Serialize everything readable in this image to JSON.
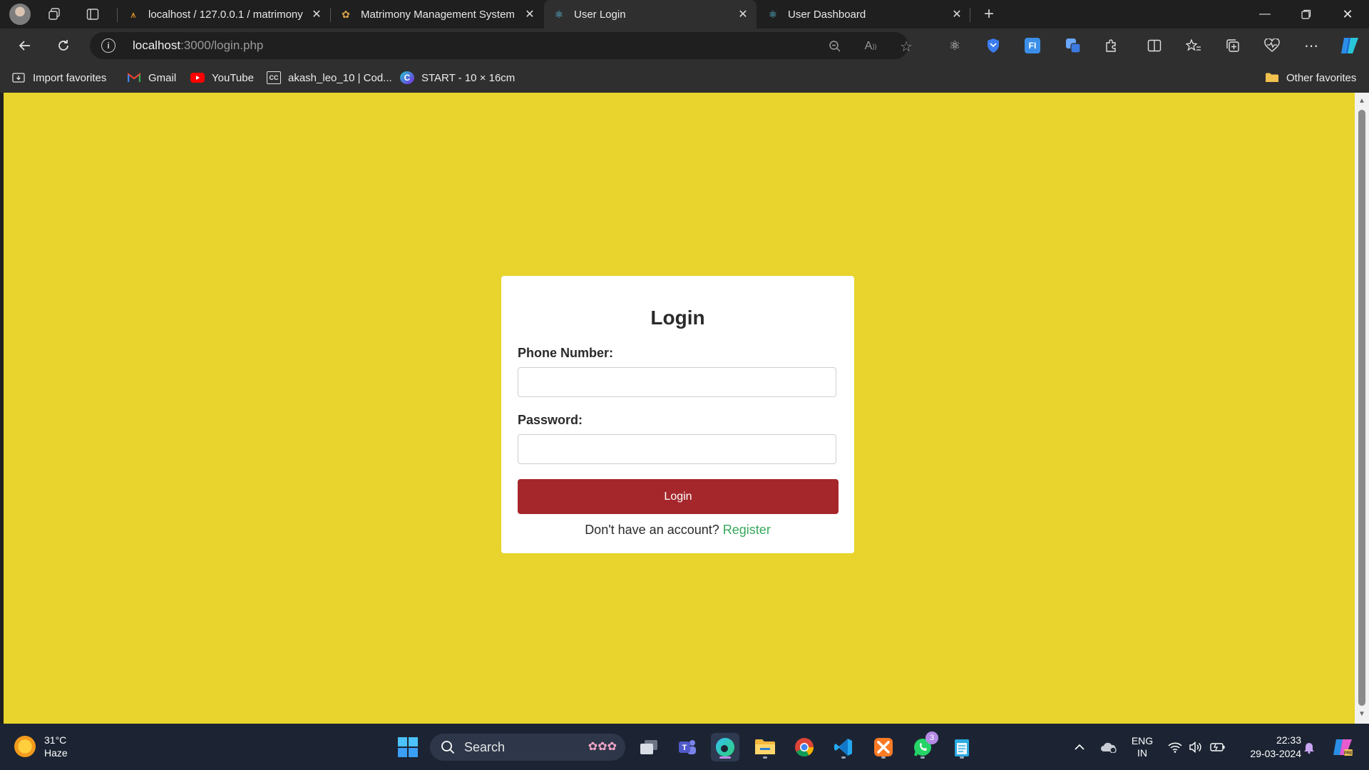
{
  "browser": {
    "tabs": [
      {
        "title": "localhost / 127.0.0.1 / matrimony",
        "favicon": "phpmyadmin-icon"
      },
      {
        "title": "Matrimony Management System",
        "favicon": "matrimony-icon"
      },
      {
        "title": "User Login",
        "favicon": "react-icon"
      },
      {
        "title": "User Dashboard",
        "favicon": "react-icon"
      }
    ],
    "active_tab_index": 2,
    "address": {
      "host": "localhost",
      "path": ":3000/login.php"
    },
    "favorites": [
      {
        "label": "Import favorites",
        "icon": "import-icon"
      },
      {
        "label": "Gmail",
        "icon": "gmail-icon"
      },
      {
        "label": "YouTube",
        "icon": "youtube-icon"
      },
      {
        "label": "akash_leo_10 | Cod...",
        "icon": "codechef-icon"
      },
      {
        "label": "START - 10 × 16cm",
        "icon": "canva-icon"
      }
    ],
    "other_favorites": "Other favorites"
  },
  "page": {
    "background": "#e8d42c",
    "form": {
      "title": "Login",
      "phone_label": "Phone Number:",
      "phone_value": "",
      "password_label": "Password:",
      "password_value": "",
      "submit_label": "Login",
      "register_prompt": "Don't have an account?",
      "register_link": "Register"
    },
    "accent_colors": {
      "button": "#a5272b",
      "link": "#36a85a"
    }
  },
  "taskbar": {
    "weather": {
      "temp": "31°C",
      "condition": "Haze"
    },
    "search_label": "Search",
    "whatsapp_badge": "3",
    "language": {
      "lang": "ENG",
      "region": "IN"
    },
    "time": "22:33",
    "date": "29-03-2024"
  }
}
